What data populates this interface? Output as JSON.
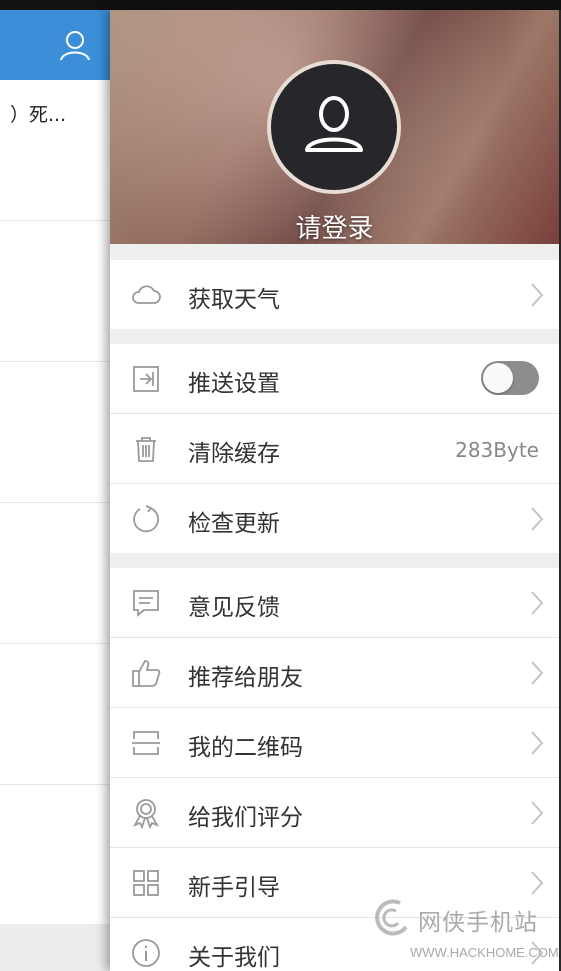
{
  "background_app": {
    "snippet": "）死..."
  },
  "drawer": {
    "login_label": "请登录",
    "groups": [
      [
        {
          "label": "获取天气",
          "icon": "cloud-icon",
          "control": "chevron"
        }
      ],
      [
        {
          "label": "推送设置",
          "icon": "push-icon",
          "control": "toggle",
          "toggle_on": false
        },
        {
          "label": "清除缓存",
          "icon": "trash-icon",
          "control": "value",
          "value": "283Byte"
        },
        {
          "label": "检查更新",
          "icon": "refresh-icon",
          "control": "chevron"
        }
      ],
      [
        {
          "label": "意见反馈",
          "icon": "feedback-icon",
          "control": "chevron"
        },
        {
          "label": "推荐给朋友",
          "icon": "thumbs-up-icon",
          "control": "chevron"
        },
        {
          "label": "我的二维码",
          "icon": "qr-code-icon",
          "control": "chevron"
        },
        {
          "label": "给我们评分",
          "icon": "award-icon",
          "control": "chevron"
        },
        {
          "label": "新手引导",
          "icon": "grid-icon",
          "control": "chevron"
        },
        {
          "label": "关于我们",
          "icon": "info-icon",
          "control": "chevron"
        }
      ]
    ]
  },
  "watermark": {
    "name": "网侠手机站",
    "url": "WWW.HACKHOME.COM"
  },
  "colors": {
    "header_blue": "#3b8fd9",
    "icon_gray": "#9a9a9a",
    "toggle_off": "#8d8d8d"
  }
}
